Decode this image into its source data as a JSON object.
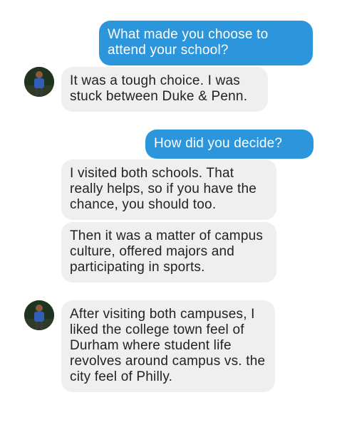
{
  "colors": {
    "sent_bubble": "#2b96dc",
    "received_bubble": "#efefef",
    "sent_text": "#ffffff",
    "received_text": "#222222"
  },
  "messages": [
    {
      "sender": "me",
      "text": "What made you choose to attend your school?"
    },
    {
      "sender": "them",
      "avatar": "student-avatar-photo",
      "text": "It was a tough choice. I was stuck between Duke & Penn."
    },
    {
      "sender": "me",
      "text": "How did you decide?"
    },
    {
      "sender": "them",
      "text": "I visited both schools. That really helps, so if you have the chance, you should too."
    },
    {
      "sender": "them",
      "text": "Then it was a matter of campus culture, offered majors and participating in sports."
    },
    {
      "sender": "them",
      "avatar": "student-avatar-photo",
      "text": "After visiting both campuses, I liked the college town feel of Durham where student life revolves around campus vs. the city feel of Philly."
    }
  ]
}
